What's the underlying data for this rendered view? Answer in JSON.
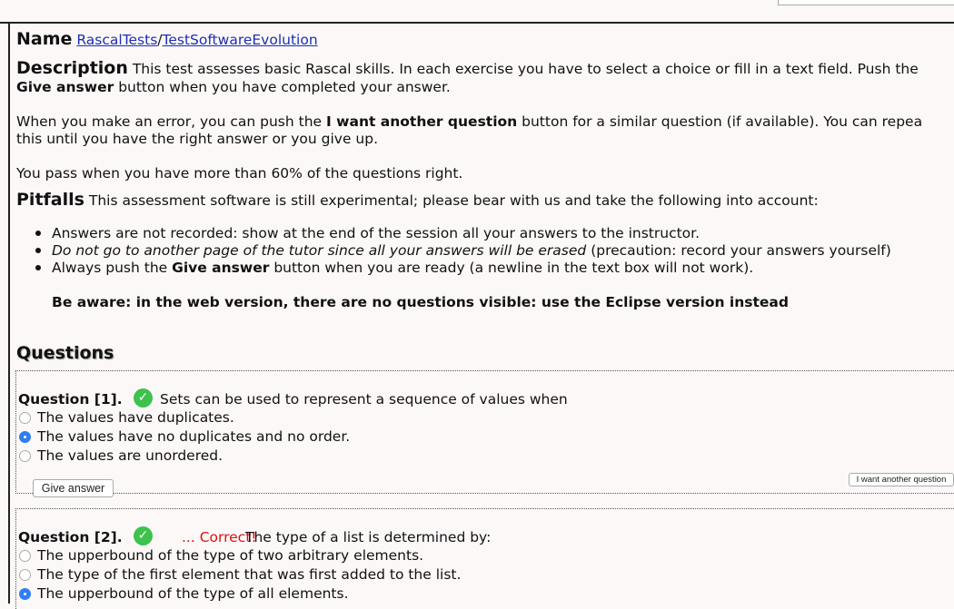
{
  "name": {
    "label": "Name",
    "link_part1": "RascalTests",
    "sep": "/",
    "link_part2": "TestSoftwareEvolution"
  },
  "description": {
    "label": "Description",
    "p1_text": "This test assesses basic Rascal skills. In each exercise you have to select a choice or fill in a text field. Push the",
    "p1_bold": "Give answer",
    "p1_rest": "button when you have completed your answer.",
    "p2_a": "When you make an error, you can push the",
    "p2_bold": "I want another question",
    "p2_b": "button for a similar question (if available). You can repea",
    "p2_c": "this until you have the right answer or you give up.",
    "p3": "You pass when you have more than 60% of the questions right."
  },
  "pitfalls": {
    "label": "Pitfalls",
    "intro": "This assessment software is still experimental; please bear with us and take the following into account:",
    "item1": "Answers are not recorded: show at the end of the session all your answers to the instructor.",
    "item2_italic": "Do not go to another page of the tutor since all your answers will be erased",
    "item2_rest": "(precaution: record your answers yourself)",
    "item3_a": "Always push the",
    "item3_bold": "Give answer",
    "item3_b": "button when you are ready (a newline in the text box will not work).",
    "warning": "Be aware: in the web version, there are no questions visible: use the Eclipse version instead"
  },
  "questions_heading": "Questions",
  "q1": {
    "label": "Question [1].",
    "text": "Sets can be used to represent a sequence of values when",
    "options": [
      "The values have duplicates.",
      "The values have no duplicates and no order.",
      "The values are unordered."
    ],
    "selected_index": 1,
    "give_answer": "Give answer",
    "another": "I want another question"
  },
  "q2": {
    "label": "Question [2].",
    "feedback": "... Correct!",
    "text": "The type of a list is determined by:",
    "options": [
      "The upperbound of the type of two arbitrary elements.",
      "The type of the first element that was first added to the list.",
      "The upperbound of the type of all elements."
    ],
    "selected_index": 2
  },
  "icons": {
    "check": "check-circle-icon",
    "accent": "#3cc24d",
    "radio_on": "#2f7ef5",
    "correct_color": "#dd1111"
  }
}
